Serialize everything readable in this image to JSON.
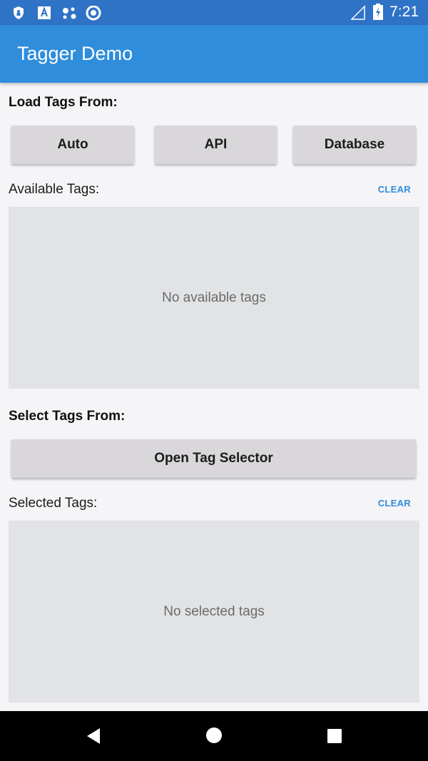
{
  "status_bar": {
    "time": "7:21",
    "icons": [
      "shield-icon",
      "font-icon",
      "assistant-icon",
      "circle-icon",
      "no-signal-icon",
      "battery-charging-icon"
    ]
  },
  "app_bar": {
    "title": "Tagger Demo"
  },
  "load_section": {
    "title": "Load Tags From:",
    "buttons": [
      "Auto",
      "API",
      "Database"
    ]
  },
  "available": {
    "label": "Available Tags:",
    "clear_label": "CLEAR",
    "empty_text": "No available tags"
  },
  "select_section": {
    "title": "Select Tags From:",
    "button_label": "Open Tag Selector"
  },
  "selected": {
    "label": "Selected Tags:",
    "clear_label": "CLEAR",
    "empty_text": "No selected tags"
  },
  "nav_bar": {
    "icons": [
      "back-icon",
      "home-icon",
      "recents-icon"
    ]
  },
  "colors": {
    "status_bar": "#2f73c6",
    "app_bar": "#2f8ddc",
    "accent": "#2f8ddc",
    "button": "#d9d7da",
    "panel": "#e1e3e5"
  }
}
